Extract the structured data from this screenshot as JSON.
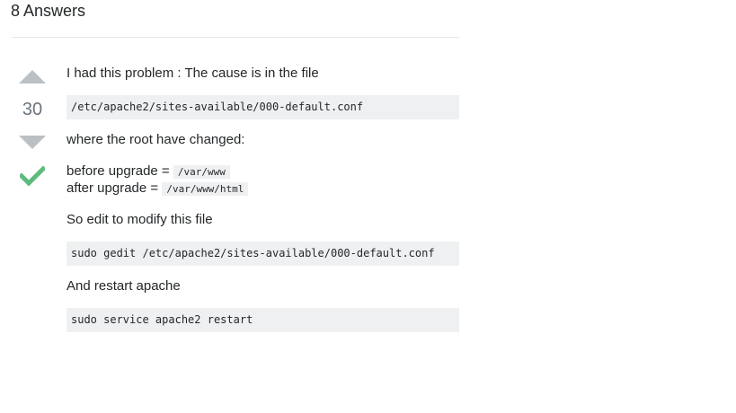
{
  "answers": {
    "title": "8 Answers"
  },
  "answer": {
    "vote_count": "30",
    "accepted": true,
    "accent_color": "#5eba7d",
    "intro": "I had this problem : The cause is in the file",
    "file_path": "/etc/apache2/sites-available/000-default.conf",
    "where_text": "where the root have changed:",
    "before_label": "before upgrade = ",
    "before_value": "/var/www",
    "after_label": "after upgrade = ",
    "after_value": "/var/www/html",
    "edit_text": "So edit to modify this file",
    "edit_command": "sudo gedit /etc/apache2/sites-available/000-default.conf",
    "restart_text": "And restart apache",
    "restart_command": "sudo service apache2 restart"
  },
  "icons": {
    "upvote": "arrow-up-icon",
    "downvote": "arrow-down-icon",
    "accepted": "checkmark-icon"
  }
}
